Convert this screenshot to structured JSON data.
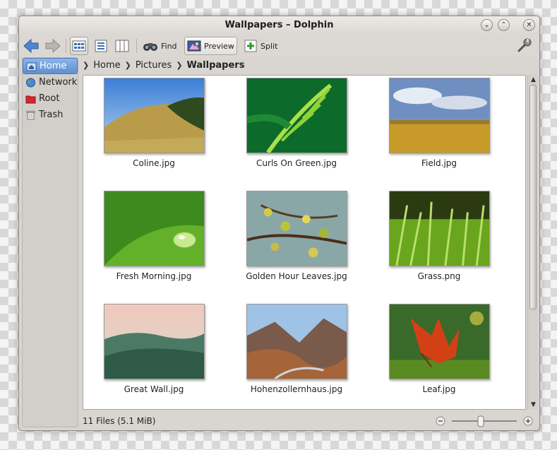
{
  "window": {
    "title": "Wallpapers – Dolphin"
  },
  "toolbar": {
    "find_label": "Find",
    "preview_label": "Preview",
    "split_label": "Split"
  },
  "places": [
    {
      "label": "Home",
      "icon": "home-icon"
    },
    {
      "label": "Network",
      "icon": "globe-icon"
    },
    {
      "label": "Root",
      "icon": "folder-red-icon"
    },
    {
      "label": "Trash",
      "icon": "trash-icon"
    }
  ],
  "breadcrumb": [
    "Home",
    "Pictures",
    "Wallpapers"
  ],
  "files": [
    {
      "name": "Coline.jpg"
    },
    {
      "name": "Curls On Green.jpg"
    },
    {
      "name": "Field.jpg"
    },
    {
      "name": "Fresh Morning.jpg"
    },
    {
      "name": "Golden Hour Leaves.jpg"
    },
    {
      "name": "Grass.png"
    },
    {
      "name": "Great Wall.jpg"
    },
    {
      "name": "Hohenzollernhaus.jpg"
    },
    {
      "name": "Leaf.jpg"
    }
  ],
  "status": {
    "text": "11 Files (5.1 MiB)"
  },
  "colors": {
    "selection": "#6d9bd9",
    "window_bg": "#d9d6d1"
  }
}
